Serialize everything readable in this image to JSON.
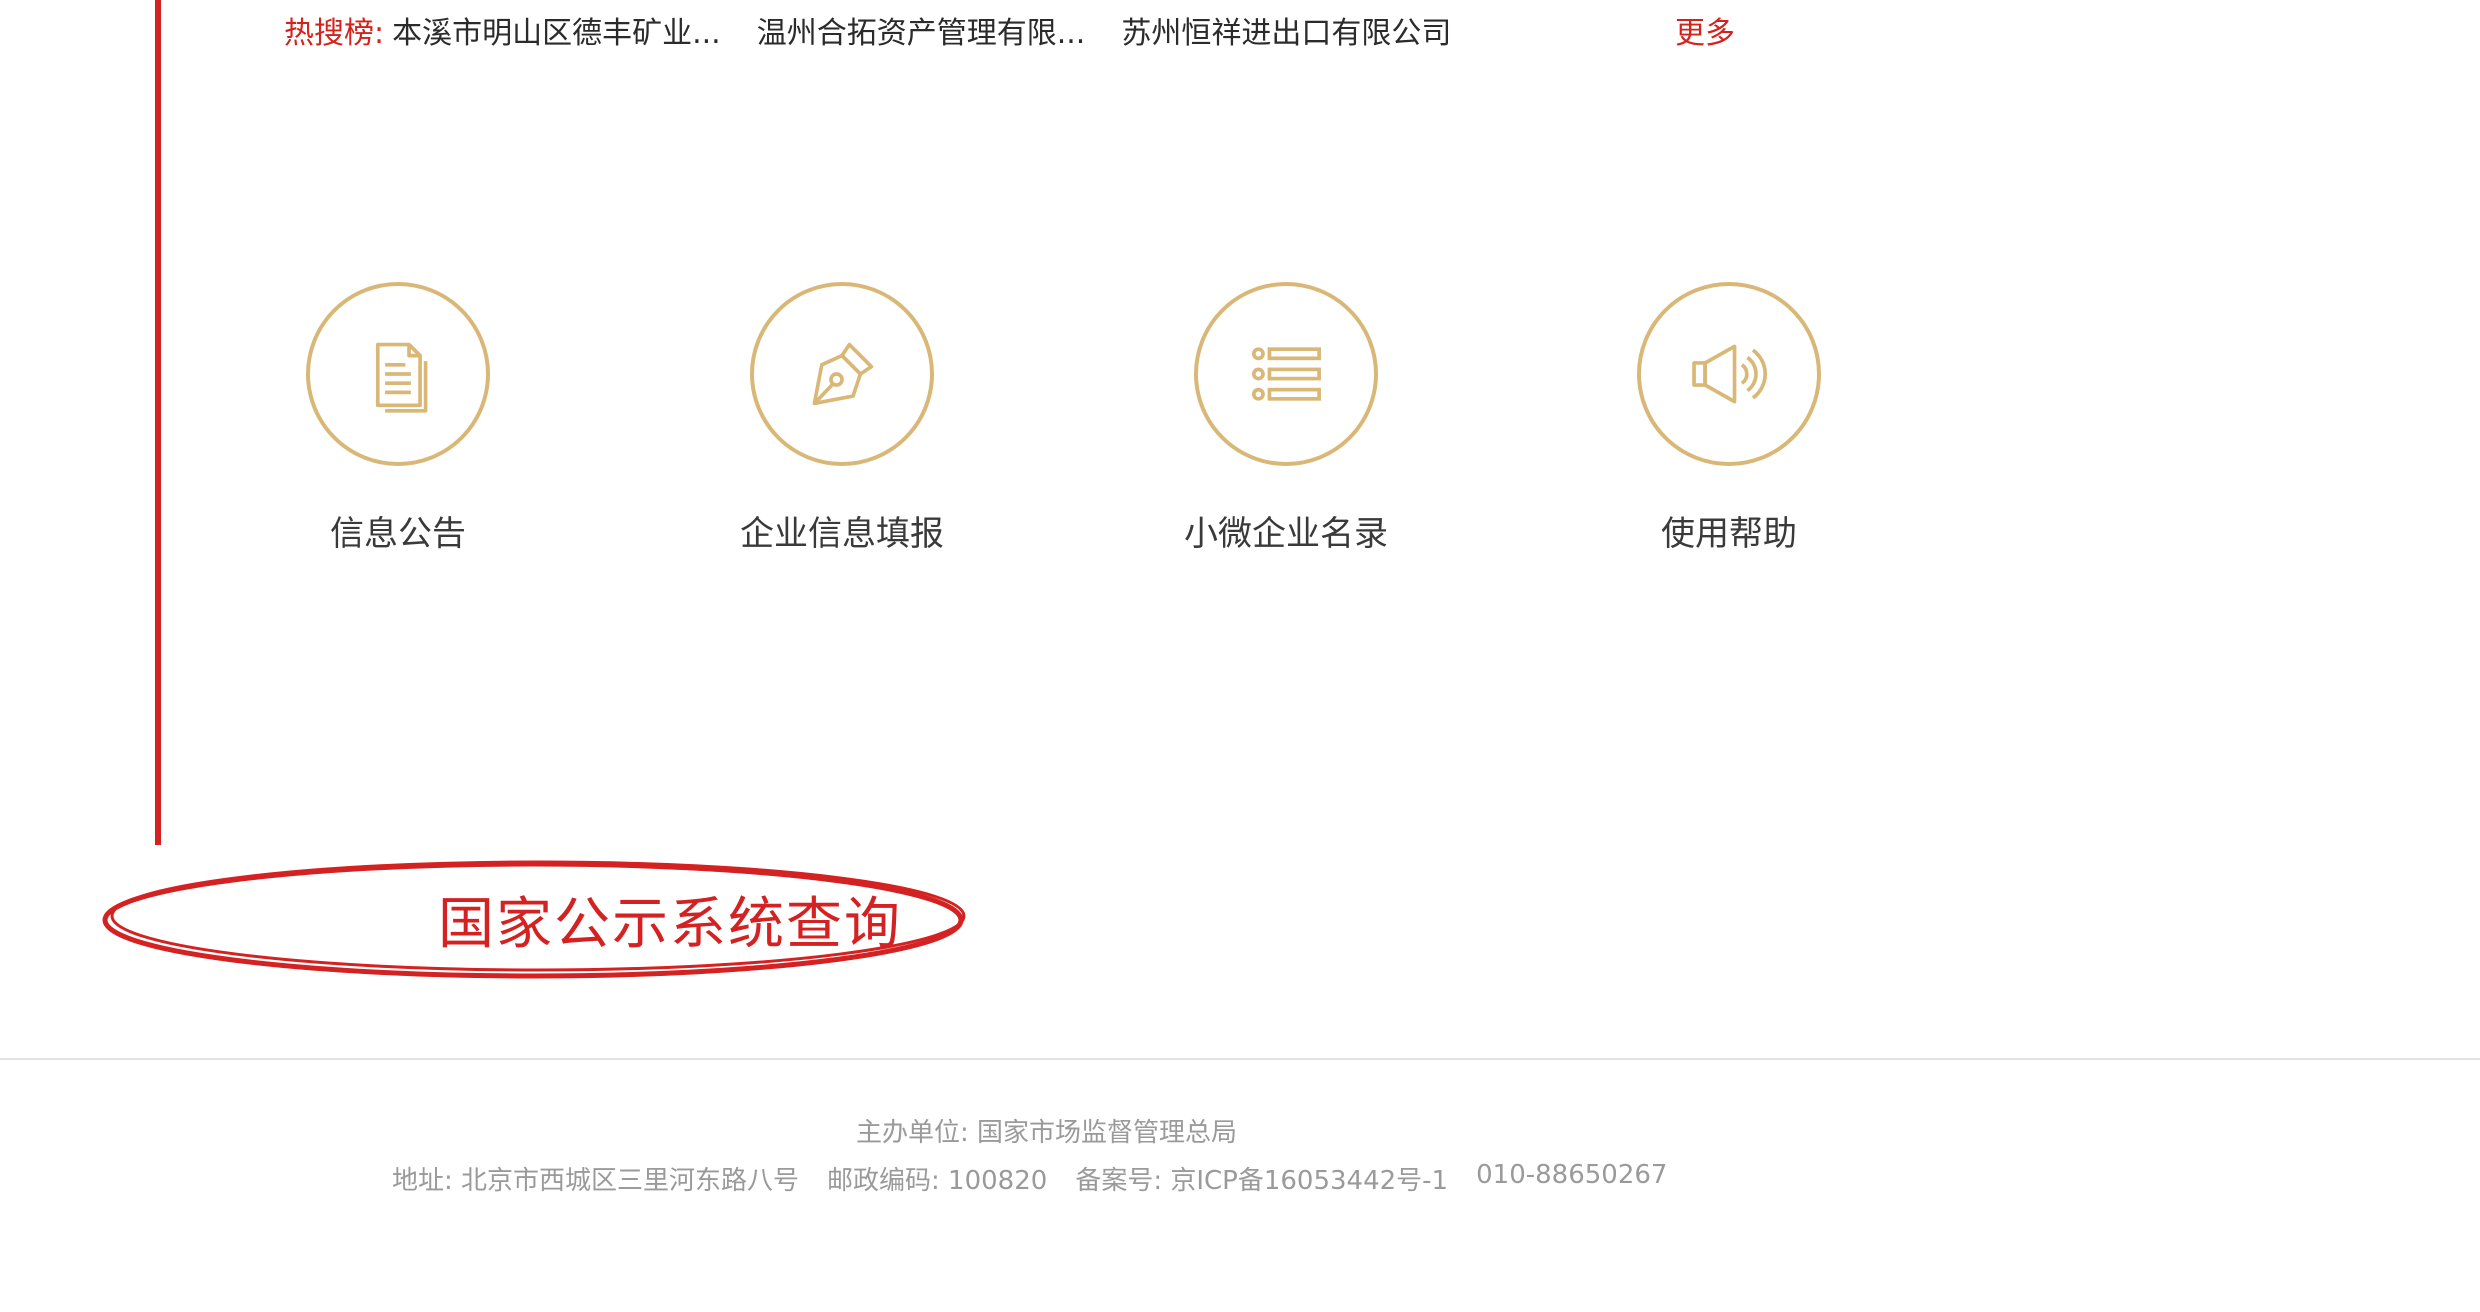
{
  "hot_search": {
    "label": "热搜榜:",
    "items": [
      "本溪市明山区德丰矿业...",
      "温州合拓资产管理有限...",
      "苏州恒祥进出口有限公司"
    ],
    "more": "更多"
  },
  "services": [
    {
      "label": "信息公告",
      "icon": "document-icon"
    },
    {
      "label": "企业信息填报",
      "icon": "pen-icon"
    },
    {
      "label": "小微企业名录",
      "icon": "list-icon"
    },
    {
      "label": "使用帮助",
      "icon": "speaker-icon"
    }
  ],
  "annotation": {
    "text": "国家公示系统查询"
  },
  "footer": {
    "sponsor": "主办单位: 国家市场监督管理总局",
    "address": "地址: 北京市西城区三里河东路八号",
    "postcode": "邮政编码: 100820",
    "icp": "备案号: 京ICP备16053442号-1",
    "phone": "010-88650267"
  },
  "colors": {
    "accent_red": "#d42121",
    "icon_gold": "#d9b877",
    "footer_text": "#9a9a9a"
  }
}
